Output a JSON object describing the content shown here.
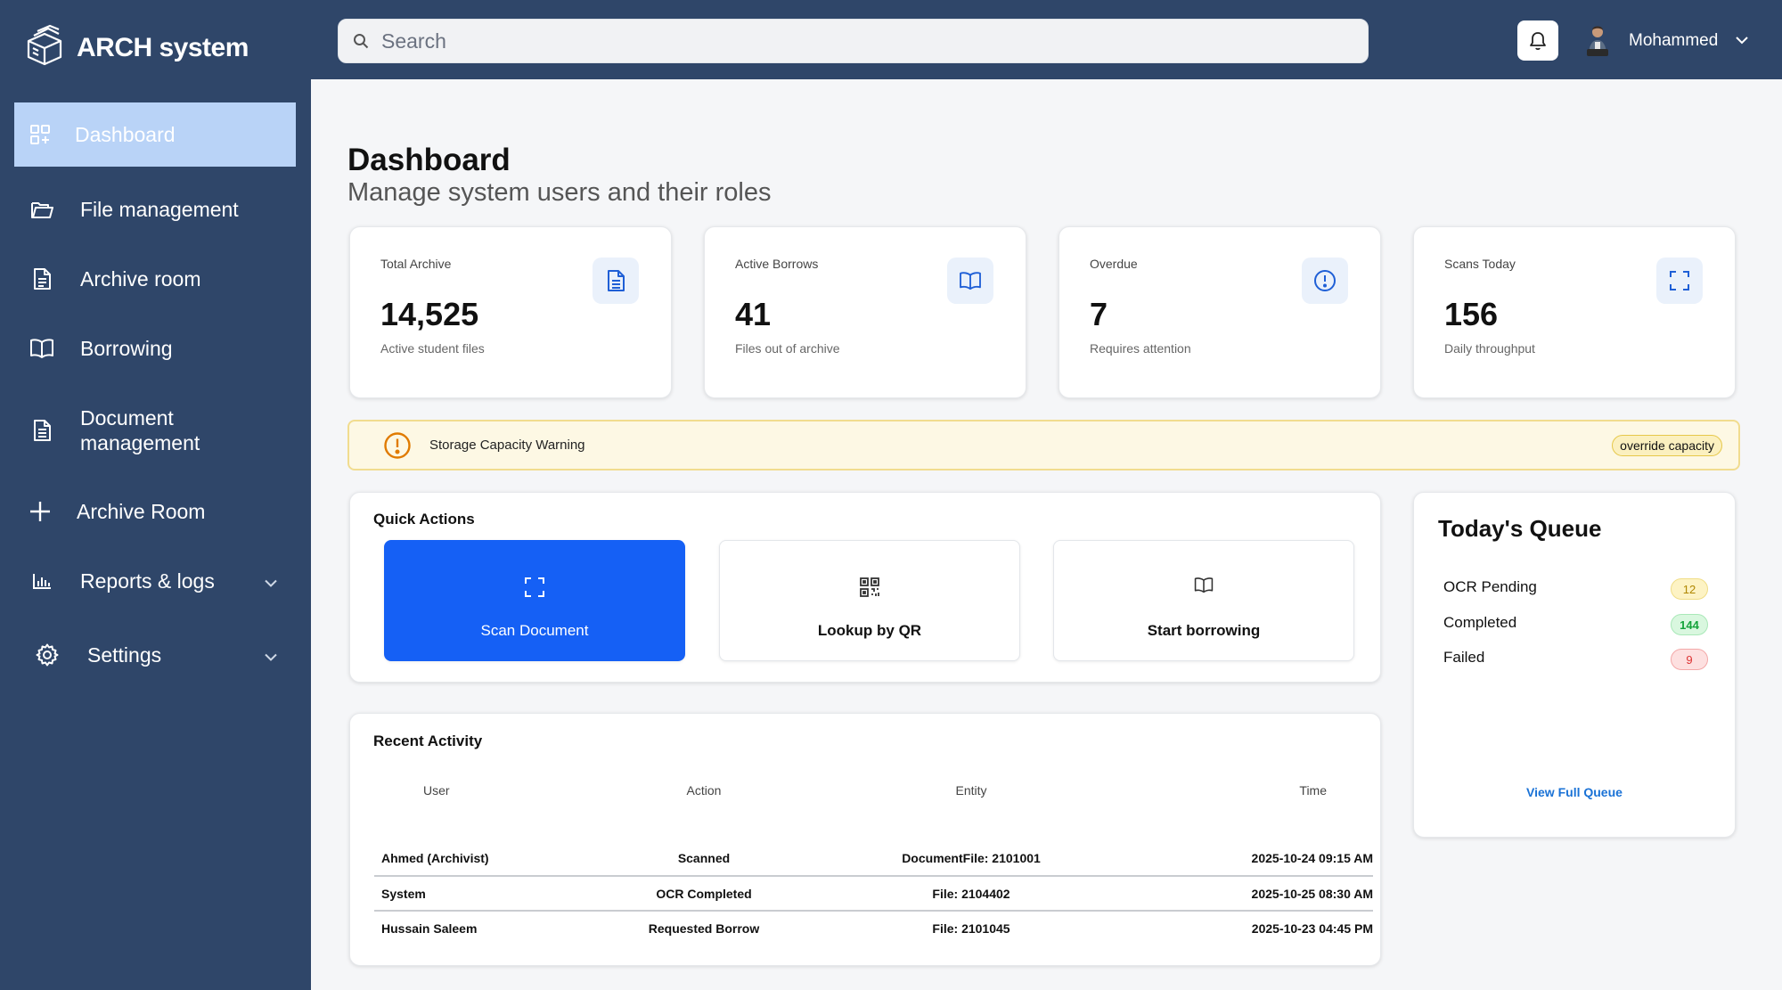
{
  "app": {
    "name": "ARCH system"
  },
  "sidebar": {
    "items": [
      {
        "label": "Dashboard",
        "icon": "dashboard-grid-icon",
        "active": true
      },
      {
        "label": "File management",
        "icon": "folder-icon"
      },
      {
        "label": "Archive room",
        "icon": "document-icon"
      },
      {
        "label": "Borrowing",
        "icon": "book-open-icon"
      },
      {
        "label": "Document management",
        "label_line1": "Document",
        "label_line2": "management",
        "icon": "document-list-icon"
      },
      {
        "label": "Archive Room",
        "icon": "plus-icon"
      },
      {
        "label": "Reports & logs",
        "icon": "bar-chart-icon",
        "expandable": true
      },
      {
        "label": "Settings",
        "icon": "gear-icon",
        "expandable": true
      }
    ]
  },
  "header": {
    "search_placeholder": "Search",
    "user_name": "Mohammed"
  },
  "main": {
    "title": "Dashboard",
    "subtitle": "Manage system users and their roles",
    "stats": [
      {
        "label": "Total Archive",
        "value": "14,525",
        "sub": "Active student files",
        "icon": "document-icon"
      },
      {
        "label": "Active Borrows",
        "value": "41",
        "sub": "Files out of archive",
        "icon": "book-open-icon"
      },
      {
        "label": "Overdue",
        "value": "7",
        "sub": "Requires attention",
        "icon": "alert-circle-icon"
      },
      {
        "label": "Scans Today",
        "value": "156",
        "sub": "Daily throughput",
        "icon": "scan-icon"
      }
    ],
    "warning": {
      "text": "Storage Capacity Warning",
      "action": "override capacity"
    },
    "quick_actions": {
      "title": "Quick Actions",
      "items": [
        {
          "label": "Scan Document",
          "icon": "scan-icon"
        },
        {
          "label": "Lookup by QR",
          "icon": "qr-code-icon"
        },
        {
          "label": "Start borrowing",
          "icon": "book-open-icon"
        }
      ]
    },
    "queue": {
      "title": "Today's Queue",
      "items": [
        {
          "label": "OCR Pending",
          "count": "12"
        },
        {
          "label": "Completed",
          "count": "144"
        },
        {
          "label": "Failed",
          "count": "9"
        }
      ],
      "link": "View Full Queue"
    },
    "activity": {
      "title": "Recent Activity",
      "columns": [
        "User",
        "Action",
        "Entity",
        "Time"
      ],
      "rows": [
        [
          "Ahmed (Archivist)",
          "Scanned",
          "DocumentFile: 2101001",
          "2025-10-24 09:15 AM"
        ],
        [
          "System",
          "OCR Completed",
          "File: 2104402",
          "2025-10-25 08:30 AM"
        ],
        [
          "Hussain Saleem",
          "Requested Borrow",
          "File: 2101045",
          "2025-10-23 04:45 PM"
        ]
      ]
    }
  },
  "colors": {
    "sidebar_bg": "#2f4669",
    "active_nav": "#b9d3f7",
    "primary": "#1560f5",
    "warning_bg": "#fdf8e4",
    "badge_yellow": "#fdf3c4",
    "badge_green": "#d9f7df",
    "badge_red": "#fde0e0"
  }
}
